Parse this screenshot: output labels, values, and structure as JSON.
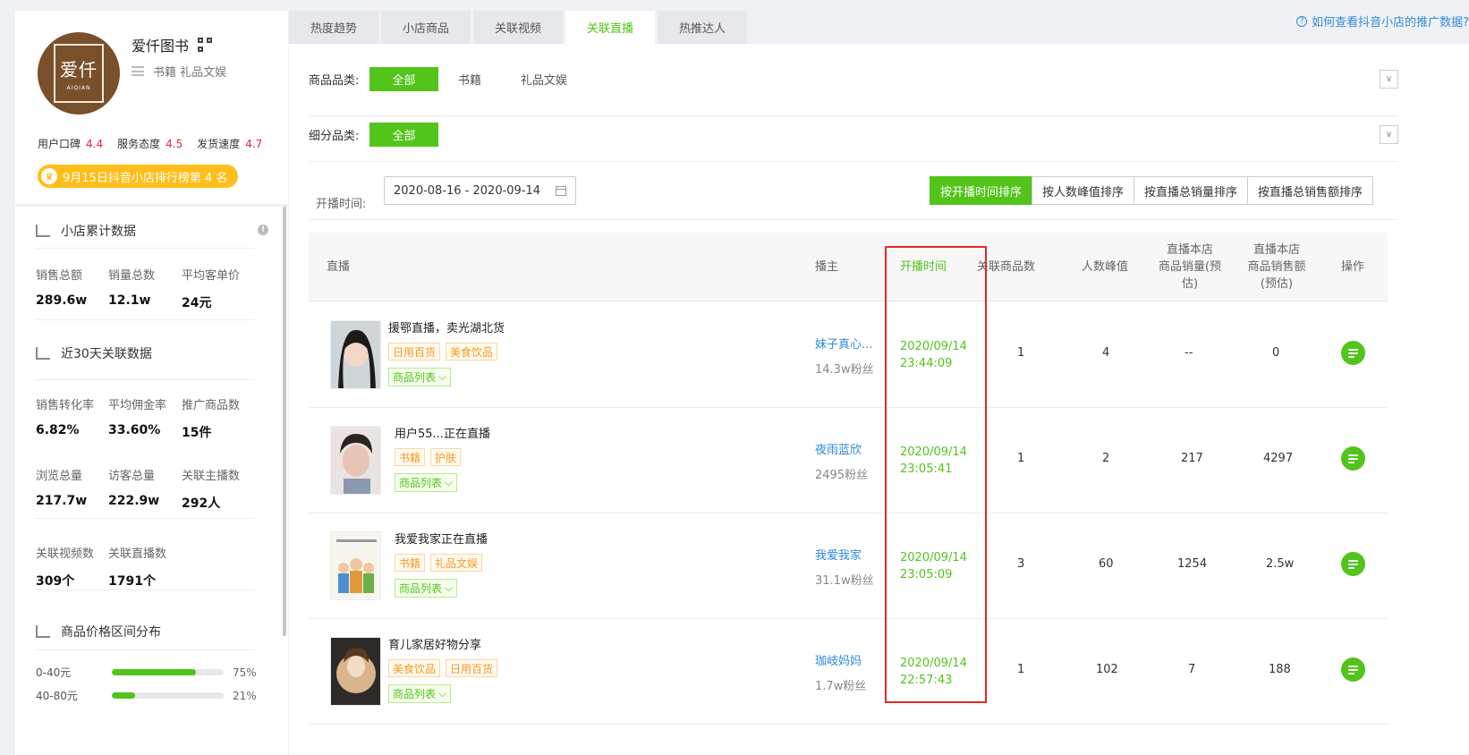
{
  "shop": {
    "name": "爱仟图书",
    "logo_text_cn": "爱仟",
    "logo_text_en": "AIQIAN",
    "categories": "书籍 礼品文娱",
    "ratings": [
      {
        "label": "用户口碑",
        "value": "4.4"
      },
      {
        "label": "服务态度",
        "value": "4.5"
      },
      {
        "label": "发货速度",
        "value": "4.7"
      }
    ],
    "rank_badge": "9月15日抖音小店排行榜第 4 名"
  },
  "stats": {
    "cumulative_title": "小店累计数据",
    "sales_total": {
      "label": "销售总额",
      "value": "289.6w"
    },
    "sales_count": {
      "label": "销量总数",
      "value": "12.1w"
    },
    "avg_price": {
      "label": "平均客单价",
      "value": "24元"
    },
    "recent_title": "近30天关联数据",
    "conversion": {
      "label": "销售转化率",
      "value": "6.82%"
    },
    "commission": {
      "label": "平均佣金率",
      "value": "33.60%"
    },
    "promo_goods": {
      "label": "推广商品数",
      "value": "15件"
    },
    "views": {
      "label": "浏览总量",
      "value": "217.7w"
    },
    "visitors": {
      "label": "访客总量",
      "value": "222.9w"
    },
    "anchors": {
      "label": "关联主播数",
      "value": "292人"
    },
    "videos": {
      "label": "关联视频数",
      "value": "309个"
    },
    "lives": {
      "label": "关联直播数",
      "value": "1791个"
    },
    "price_dist_title": "商品价格区间分布",
    "price_dist": [
      {
        "label": "0-40元",
        "pct": "75%",
        "fraction": 0.75
      },
      {
        "label": "40-80元",
        "pct": "21%",
        "fraction": 0.21
      }
    ]
  },
  "tabs": [
    "热度趋势",
    "小店商品",
    "关联视频",
    "关联直播",
    "热推达人"
  ],
  "active_tab": "关联直播",
  "help_link": "如何查看抖音小店的推广数据?",
  "filters": {
    "category_label": "商品品类:",
    "category_options": [
      "全部",
      "书籍",
      "礼品文娱"
    ],
    "subcategory_label": "细分品类:",
    "subcategory_options": [
      "全部"
    ],
    "date_label": "开播时间:",
    "date_range": "2020-08-16 - 2020-09-14"
  },
  "sort_buttons": [
    "按开播时间排序",
    "按人数峰值排序",
    "按直播总销量排序",
    "按直播总销售额排序"
  ],
  "table": {
    "headers": {
      "live": "直播",
      "anchor": "播主",
      "start": "开播时间",
      "goods": "关联商品数",
      "peak": "人数峰值",
      "sales_1": "直播本店",
      "sales_2": "商品销量(预",
      "sales_3": "估)",
      "amount_1": "直播本店",
      "amount_2": "商品销售额",
      "amount_3": "(预估)",
      "op": "操作"
    },
    "goods_list_label": "商品列表",
    "rows": [
      {
        "title": "援鄂直播，卖光湖北货",
        "tags": [
          "日用百货",
          "美食饮品"
        ],
        "anchor": "妹子真心...",
        "fans": "14.3w粉丝",
        "date": "2020/09/14",
        "time": "23:44:09",
        "goods": "1",
        "peak": "4",
        "sales": "--",
        "amount": "0"
      },
      {
        "title": "用户55...正在直播",
        "tags": [
          "书籍",
          "护肤"
        ],
        "anchor": "夜雨蓝欣",
        "fans": "2495粉丝",
        "date": "2020/09/14",
        "time": "23:05:41",
        "goods": "1",
        "peak": "2",
        "sales": "217",
        "amount": "4297"
      },
      {
        "title": "我爱我家正在直播",
        "tags": [
          "书籍",
          "礼品文娱"
        ],
        "anchor": "我爱我家",
        "fans": "31.1w粉丝",
        "date": "2020/09/14",
        "time": "23:05:09",
        "goods": "3",
        "peak": "60",
        "sales": "1254",
        "amount": "2.5w"
      },
      {
        "title": "育儿家居好物分享",
        "tags": [
          "美食饮品",
          "日用百货"
        ],
        "anchor": "珈岐妈妈",
        "fans": "1.7w粉丝",
        "date": "2020/09/14",
        "time": "22:57:43",
        "goods": "1",
        "peak": "102",
        "sales": "7",
        "amount": "188"
      }
    ]
  },
  "colors": {
    "accent": "#52c41a",
    "link": "#2e8ad8",
    "rating": "#e5263a",
    "badge": "#ffbe1a",
    "highlight_box": "#e02a2a"
  }
}
